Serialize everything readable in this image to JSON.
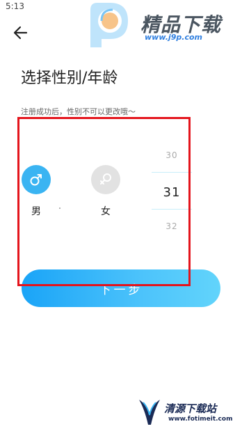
{
  "status_bar": {
    "time": "5:13"
  },
  "watermark_top": {
    "title": "精品下载",
    "url": "www.j9p.com"
  },
  "page": {
    "title": "选择性别/年龄",
    "hint": "注册成功后，性别不可以更改哦～"
  },
  "gender": {
    "male_label": "男",
    "female_label": "女",
    "selected": "男"
  },
  "age_picker": {
    "prev": "30",
    "current": "31",
    "next": "32"
  },
  "next_button": {
    "label": "下一步"
  },
  "watermark_bottom": {
    "title": "清源下载站",
    "url": "www.fotimeit.com"
  },
  "colors": {
    "accent": "#3ab4f2",
    "button_gradient_start": "#1aa4f7",
    "button_gradient_end": "#62d4fb",
    "highlight": "#e4141c"
  },
  "icons": [
    "back-arrow-icon",
    "male-symbol-icon",
    "female-symbol-icon"
  ]
}
